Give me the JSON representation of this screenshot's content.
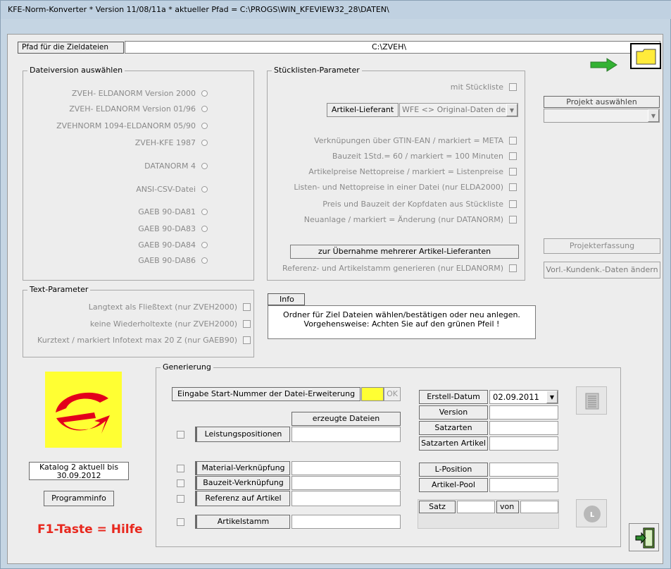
{
  "window": {
    "title": "KFE-Norm-Konverter * Version 11/08/11a * aktueller Pfad = C:\\PROGS\\WIN_KFEVIEW32_28\\DATEN\\"
  },
  "path": {
    "label": "Pfad für die Zieldateien",
    "value": "C:\\ZVEH\\"
  },
  "dateiversion": {
    "title": "Dateiversion auswählen",
    "options": [
      "ZVEH- ELDANORM Version 2000",
      "ZVEH- ELDANORM Version 01/96",
      "ZVEHNORM 1094-ELDANORM 05/90",
      "ZVEH-KFE 1987",
      "DATANORM 4",
      "ANSI-CSV-Datei",
      "GAEB 90-DA81",
      "GAEB 90-DA83",
      "GAEB 90-DA84",
      "GAEB 90-DA86"
    ]
  },
  "stueckliste": {
    "title": "Stücklisten-Parameter",
    "mit_stueckliste": "mit Stückliste",
    "artikel_lieferant_label": "Artikel-Lieferant",
    "artikel_lieferant_value": "WFE <> Original-Daten der",
    "options": [
      "Verknüpungen über GTIN-EAN  / markiert = META",
      "Bauzeit 1Std.= 60 / markiert = 100 Minuten",
      "Artikelpreise  Nettopreise / markiert = Listenpreise",
      "Listen- und Nettopreise in einer Datei (nur ELDA2000)",
      "Preis und Bauzeit der Kopfdaten aus Stückliste",
      "Neuanlage / markiert = Änderung (nur DATANORM)"
    ],
    "mehrere_button": "zur Übernahme mehrerer Artikel-Lieferanten",
    "referenz": "Referenz- und Artikelstamm generieren (nur ELDANORM)"
  },
  "projekt": {
    "auswaehlen": "Projekt auswählen",
    "erfassung": "Projekterfassung",
    "kundendaten": "Vorl.-Kundenk.-Daten ändern"
  },
  "textparam": {
    "title": "Text-Parameter",
    "options": [
      "Langtext als Fließtext (nur ZVEH2000)",
      "keine Wiederholtexte (nur ZVEH2000)",
      "Kurztext  / markiert Infotext max 20 Z  (nur GAEB90)"
    ]
  },
  "info": {
    "tab": "Info",
    "line1": "Ordner für Ziel Dateien wählen/bestätigen oder neu anlegen.",
    "line2": "Vorgehensweise: Achten Sie auf den grünen Pfeil !"
  },
  "left": {
    "katalog_line1": "Katalog 2 aktuell bis",
    "katalog_line2": "30.09.2012",
    "programminfo": "Programminfo",
    "hilfe": "F1-Taste = Hilfe"
  },
  "generierung": {
    "title": "Generierung",
    "start_label": "Eingabe Start-Nummer der Datei-Erweiterung",
    "ok": "OK",
    "erzeugte": "erzeugte Dateien",
    "rows": [
      "Leistungspositionen",
      "Material-Verknüpfung",
      "Bauzeit-Verknüpfung",
      "Referenz auf Artikel",
      "Artikelstamm"
    ],
    "erstell_label": "Erstell-Datum",
    "erstell_value": "02.09.2011",
    "version": "Version",
    "satzarten": "Satzarten",
    "satzarten_artikel": "Satzarten Artikel",
    "lposition": "L-Position",
    "artikelpool": "Artikel-Pool",
    "satz": "Satz",
    "von": "von"
  },
  "colors": {
    "accent_yellow": "#ffff33",
    "green_arrow": "#33b233",
    "help_red": "#e8281e",
    "logo_red": "#e3001b"
  }
}
